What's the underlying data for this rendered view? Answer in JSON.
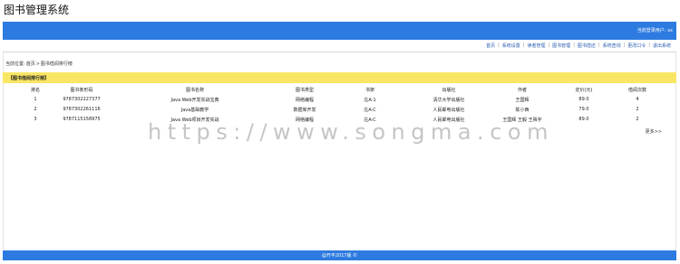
{
  "app": {
    "title": "图书管理系统"
  },
  "header": {
    "user_info": "当前登录用户: xx"
  },
  "nav": {
    "items": [
      "首页",
      "系统设置",
      "读者管理",
      "图书管理",
      "图书借还",
      "系统查询",
      "更改口令",
      "退出系统"
    ]
  },
  "breadcrumb": {
    "prefix": "当前位置:",
    "home": "首页",
    "separator": ">",
    "current": "图书借阅排行榜"
  },
  "section": {
    "title": "【图书借阅排行榜】"
  },
  "table": {
    "headers": [
      "排名",
      "图书条形码",
      "图书名称",
      "图书类型",
      "书架",
      "出版社",
      "作者",
      "定价(元)",
      "借阅次数"
    ],
    "rows": [
      [
        "1",
        "9787302227377",
        "Java Web开发实战宝典",
        "网络编程",
        "左A-1",
        "清华大学出版社",
        "王国辉",
        "89.0",
        "4"
      ],
      [
        "2",
        "9787302261116",
        "Java基础教学",
        "数据库开发",
        "左A-C",
        "人民邮电出版社",
        "陈小西",
        "79.0",
        "2"
      ],
      [
        "3",
        "9787115158975",
        "Java Web项目开发实战",
        "网络编程",
        "左A-C",
        "人民邮电出版社",
        "王国辉 王毅 王殊宇",
        "89.0",
        "2"
      ]
    ],
    "more": "更多>>"
  },
  "watermark": {
    "text": "https://www.songma.com"
  },
  "footer": {
    "text": "@开平2017版 ©"
  },
  "colors": {
    "primary_bar": "#2d7be0",
    "section_bar": "#f9e664",
    "link": "#2a5db0"
  }
}
